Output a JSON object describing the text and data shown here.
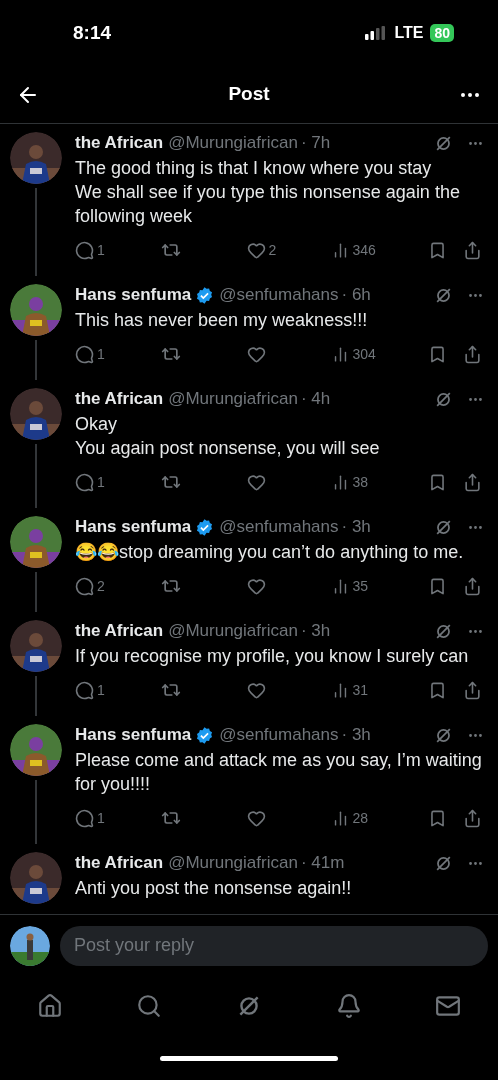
{
  "status_bar": {
    "time": "8:14",
    "network": "LTE",
    "battery": "80"
  },
  "header": {
    "title": "Post"
  },
  "replies": [
    {
      "name": "the African",
      "verified": false,
      "handle": "@Murungiafrican",
      "time": "· 7h",
      "lines": [
        "The good thing is that I know where you stay",
        "We shall see if you type this nonsense again the following week"
      ],
      "replies": "1",
      "likes": "2",
      "views": "346"
    },
    {
      "name": "Hans senfuma",
      "verified": true,
      "handle": "@senfumahans",
      "time": "· 6h",
      "lines": [
        "This has never been my weakness!!!"
      ],
      "replies": "1",
      "views": "304"
    },
    {
      "name": "the African",
      "verified": false,
      "handle": "@Murungiafrican",
      "time": "· 4h",
      "lines": [
        "Okay",
        "You again post nonsense, you will see"
      ],
      "replies": "1",
      "views": "38"
    },
    {
      "name": "Hans senfuma",
      "verified": true,
      "handle": "@senfumahans",
      "time": "· 3h",
      "lines": [
        "😂😂stop dreaming you can’t do anything to me."
      ],
      "replies": "2",
      "views": "35"
    },
    {
      "name": "the African",
      "verified": false,
      "handle": "@Murungiafrican",
      "time": "· 3h",
      "lines": [
        "If you recognise my profile, you know I surely can"
      ],
      "replies": "1",
      "views": "31"
    },
    {
      "name": "Hans senfuma",
      "verified": true,
      "handle": "@senfumahans",
      "time": "· 3h",
      "lines": [
        "Please come and attack me as you say, I’m waiting for you!!!!"
      ],
      "replies": "1",
      "views": "28"
    },
    {
      "name": "the African",
      "verified": false,
      "handle": "@Murungiafrican",
      "time": "· 41m",
      "lines": [
        "Anti you post the nonsense again!!"
      ]
    }
  ],
  "reply_bar": {
    "placeholder": "Post your reply"
  }
}
